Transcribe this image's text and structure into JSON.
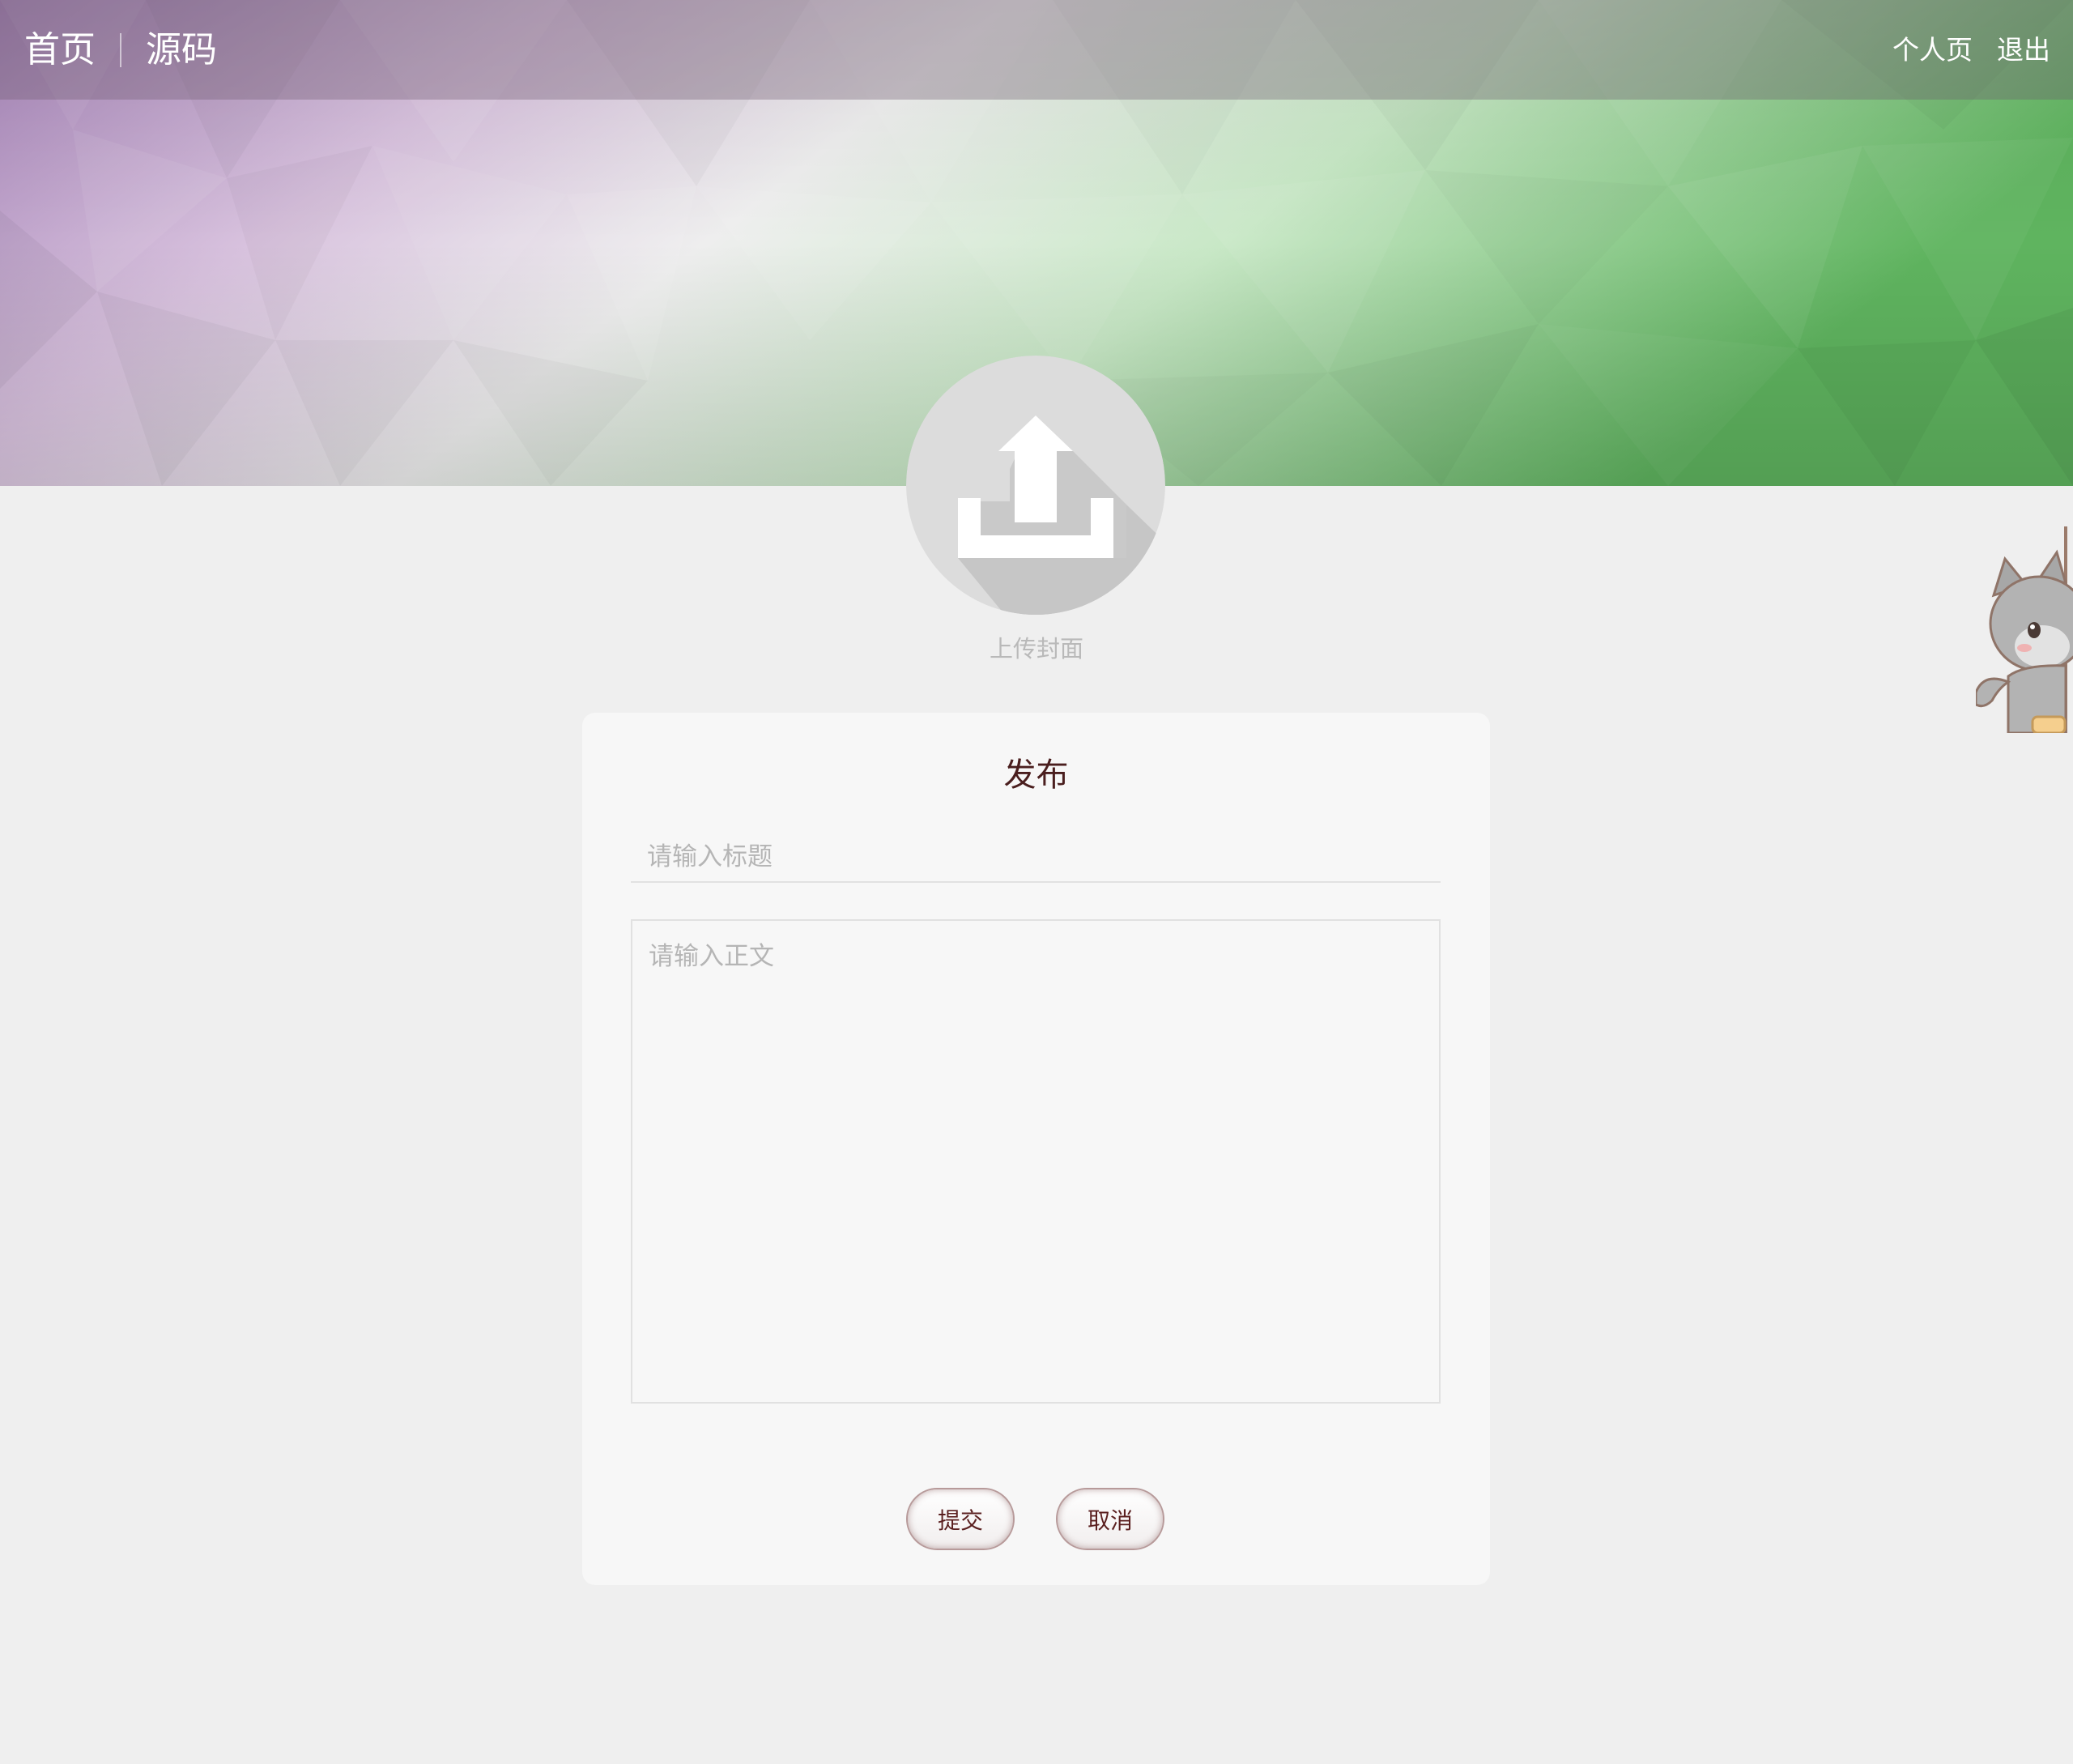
{
  "nav": {
    "home": "首页",
    "source": "源码",
    "profile": "个人页",
    "logout": "退出"
  },
  "upload": {
    "label": "上传封面",
    "icon": "upload-icon"
  },
  "form": {
    "title": "发布",
    "title_placeholder": "请输入标题",
    "body_placeholder": "请输入正文",
    "submit_label": "提交",
    "cancel_label": "取消"
  },
  "colors": {
    "page_background": "#efefef",
    "card_background": "#f7f7f7",
    "accent_text": "#4a1e1e",
    "hero_left": "#a583b7",
    "hero_right": "#5fb45f"
  }
}
